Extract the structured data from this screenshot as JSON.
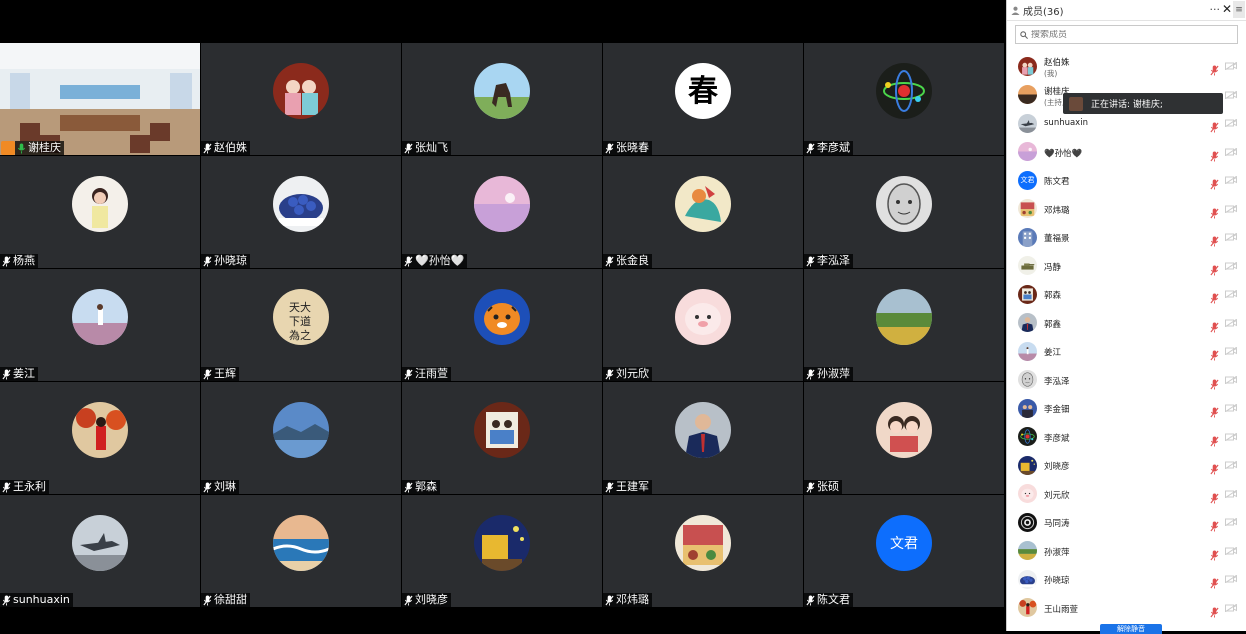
{
  "grid": [
    {
      "name": "谢桂庆",
      "type": "camera",
      "host": true
    },
    {
      "name": "赵伯姝",
      "type": "avatar",
      "av": "girls"
    },
    {
      "name": "张灿飞",
      "type": "avatar",
      "av": "horse"
    },
    {
      "name": "张晓春",
      "type": "avatar",
      "av": "chun"
    },
    {
      "name": "李彦斌",
      "type": "avatar",
      "av": "atom"
    },
    {
      "name": "杨燕",
      "type": "avatar",
      "av": "girl"
    },
    {
      "name": "孙晓琼",
      "type": "avatar",
      "av": "berries"
    },
    {
      "name": "🤍孙怡🤍",
      "type": "avatar",
      "av": "pink"
    },
    {
      "name": "张金良",
      "type": "avatar",
      "av": "painting"
    },
    {
      "name": "李泓泽",
      "type": "avatar",
      "av": "sketch"
    },
    {
      "name": "姜江",
      "type": "avatar",
      "av": "field"
    },
    {
      "name": "王辉",
      "type": "avatar",
      "av": "calligraphy"
    },
    {
      "name": "汪雨萱",
      "type": "avatar",
      "av": "tiger"
    },
    {
      "name": "刘元欣",
      "type": "avatar",
      "av": "pig"
    },
    {
      "name": "孙淑萍",
      "type": "avatar",
      "av": "landscape"
    },
    {
      "name": "王永利",
      "type": "avatar",
      "av": "autumn"
    },
    {
      "name": "刘琳",
      "type": "avatar",
      "av": "lake"
    },
    {
      "name": "郭森",
      "type": "avatar",
      "av": "frame"
    },
    {
      "name": "王建军",
      "type": "avatar",
      "av": "suit"
    },
    {
      "name": "张硕",
      "type": "avatar",
      "av": "couple"
    },
    {
      "name": "sunhuaxin",
      "type": "avatar",
      "av": "jet"
    },
    {
      "name": "徐甜甜",
      "type": "avatar",
      "av": "sea"
    },
    {
      "name": "刘晓彦",
      "type": "avatar",
      "av": "vangogh"
    },
    {
      "name": "邓炜璐",
      "type": "avatar",
      "av": "shop"
    },
    {
      "name": "陈文君",
      "type": "text",
      "av_text": "文君"
    }
  ],
  "panel": {
    "title": "成员(36)",
    "more": "···",
    "close": "✕",
    "search_placeholder": "搜索成员",
    "members": [
      {
        "name": "赵伯姝",
        "sub": "(我)",
        "av": "girls"
      },
      {
        "name": "谢桂庆",
        "sub": "(主持人)",
        "av": "sunset"
      },
      {
        "name": "sunhuaxin",
        "sub": "",
        "av": "jet"
      },
      {
        "name": "🖤孙怡🖤",
        "sub": "",
        "av": "pink"
      },
      {
        "name": "陈文君",
        "sub": "",
        "av": "text",
        "av_text": "文君"
      },
      {
        "name": "邓炜璐",
        "sub": "",
        "av": "shop"
      },
      {
        "name": "董福景",
        "sub": "",
        "av": "building"
      },
      {
        "name": "冯静",
        "sub": "",
        "av": "tank"
      },
      {
        "name": "郭森",
        "sub": "",
        "av": "frame"
      },
      {
        "name": "郭鑫",
        "sub": "",
        "av": "suit"
      },
      {
        "name": "姜江",
        "sub": "",
        "av": "field"
      },
      {
        "name": "李泓泽",
        "sub": "",
        "av": "sketch"
      },
      {
        "name": "李金钿",
        "sub": "",
        "av": "people"
      },
      {
        "name": "李彦斌",
        "sub": "",
        "av": "atom"
      },
      {
        "name": "刘晓彦",
        "sub": "",
        "av": "vangogh"
      },
      {
        "name": "刘元欣",
        "sub": "",
        "av": "pig"
      },
      {
        "name": "马同涛",
        "sub": "",
        "av": "eye"
      },
      {
        "name": "孙淑萍",
        "sub": "",
        "av": "landscape"
      },
      {
        "name": "孙晓琼",
        "sub": "",
        "av": "berries"
      },
      {
        "name": "王山雨萱",
        "sub": "",
        "av": "autumn"
      }
    ]
  },
  "speaking": {
    "text": "正在讲话: 谢桂庆;"
  },
  "unmute_button": "解除静音",
  "colors": {
    "tile_bg": "#2b2d30",
    "active_border": "#2ebd4b",
    "accent": "#0d6efd",
    "host_badge": "#f08a24",
    "mic_muted": "#e05050"
  }
}
